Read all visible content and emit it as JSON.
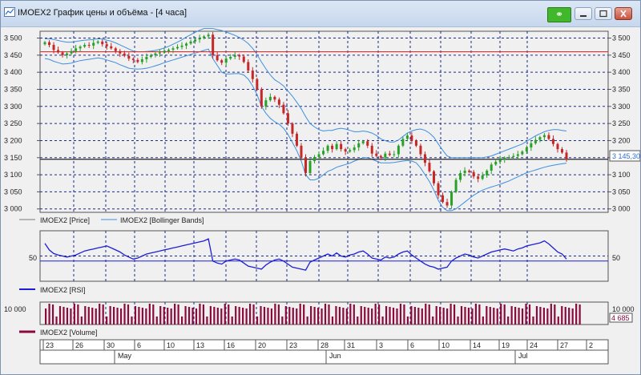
{
  "window": {
    "title": "IMOEX2 График цены и объёма - [4 часа]",
    "link_icon": "link-icon",
    "buttons": [
      "minimize-icon",
      "maximize-icon",
      "close-icon"
    ]
  },
  "chart_data": [
    {
      "type": "candlestick",
      "title": "",
      "ylim": [
        2990,
        3520
      ],
      "yticks": [
        "3 500",
        "3 450",
        "3 400",
        "3 350",
        "3 300",
        "3 250",
        "3 200",
        "3 150",
        "3 100",
        "3 050",
        "3 000"
      ],
      "ytick_values": [
        3500,
        3450,
        3400,
        3350,
        3300,
        3250,
        3200,
        3150,
        3100,
        3050,
        3000
      ],
      "hline_red": 3460,
      "hline_black": 3145.3,
      "last_price_label": "3 145,30",
      "close": [
        3488,
        3480,
        3465,
        3458,
        3450,
        3455,
        3462,
        3470,
        3475,
        3480,
        3478,
        3486,
        3490,
        3482,
        3476,
        3470,
        3462,
        3455,
        3448,
        3440,
        3436,
        3430,
        3438,
        3445,
        3450,
        3455,
        3458,
        3462,
        3466,
        3470,
        3474,
        3478,
        3484,
        3490,
        3496,
        3500,
        3505,
        3510,
        3450,
        3435,
        3428,
        3440,
        3445,
        3450,
        3446,
        3430,
        3405,
        3380,
        3350,
        3300,
        3318,
        3328,
        3320,
        3305,
        3280,
        3250,
        3220,
        3185,
        3150,
        3105,
        3140,
        3152,
        3160,
        3170,
        3185,
        3175,
        3190,
        3175,
        3168,
        3172,
        3180,
        3192,
        3198,
        3185,
        3162,
        3155,
        3150,
        3162,
        3158,
        3160,
        3185,
        3205,
        3215,
        3200,
        3185,
        3160,
        3135,
        3110,
        3075,
        3040,
        3020,
        3010,
        3050,
        3085,
        3105,
        3112,
        3108,
        3095,
        3088,
        3098,
        3112,
        3130,
        3138,
        3145,
        3150,
        3152,
        3155,
        3160,
        3168,
        3180,
        3192,
        3202,
        3210,
        3216,
        3205,
        3190,
        3175,
        3165,
        3145
      ],
      "bollinger": {
        "upper": [
          3498,
          3498,
          3496,
          3493,
          3490,
          3488,
          3488,
          3490,
          3492,
          3494,
          3495,
          3496,
          3498,
          3497,
          3494,
          3491,
          3486,
          3480,
          3474,
          3468,
          3462,
          3460,
          3460,
          3461,
          3462,
          3464,
          3467,
          3471,
          3476,
          3482,
          3488,
          3495,
          3503,
          3510,
          3517,
          3523,
          3528,
          3528,
          3528,
          3525,
          3522,
          3518,
          3513,
          3508,
          3502,
          3494,
          3484,
          3470,
          3452,
          3430,
          3410,
          3392,
          3378,
          3370,
          3360,
          3345,
          3330,
          3312,
          3293,
          3270,
          3250,
          3240,
          3232,
          3228,
          3230,
          3230,
          3234,
          3236,
          3234,
          3230,
          3226,
          3226,
          3228,
          3226,
          3222,
          3215,
          3205,
          3200,
          3196,
          3196,
          3202,
          3212,
          3222,
          3228,
          3232,
          3234,
          3230,
          3222,
          3210,
          3190,
          3172,
          3155,
          3150,
          3150,
          3150,
          3150,
          3150,
          3150,
          3150,
          3150,
          3152,
          3155,
          3160,
          3165,
          3170,
          3175,
          3180,
          3185,
          3190,
          3198,
          3206,
          3214,
          3220,
          3226,
          3230,
          3232,
          3232,
          3230,
          3228
        ],
        "lower": [
          3440,
          3438,
          3432,
          3428,
          3424,
          3425,
          3427,
          3431,
          3434,
          3436,
          3438,
          3440,
          3442,
          3440,
          3436,
          3432,
          3428,
          3422,
          3417,
          3412,
          3410,
          3409,
          3410,
          3412,
          3415,
          3419,
          3423,
          3428,
          3432,
          3436,
          3440,
          3444,
          3448,
          3452,
          3456,
          3460,
          3464,
          3468,
          3440,
          3420,
          3400,
          3395,
          3395,
          3396,
          3396,
          3392,
          3380,
          3360,
          3335,
          3300,
          3280,
          3265,
          3255,
          3248,
          3236,
          3218,
          3195,
          3170,
          3140,
          3100,
          3085,
          3085,
          3090,
          3100,
          3110,
          3115,
          3122,
          3126,
          3130,
          3134,
          3140,
          3145,
          3150,
          3150,
          3145,
          3140,
          3135,
          3135,
          3135,
          3136,
          3138,
          3140,
          3142,
          3140,
          3135,
          3120,
          3100,
          3080,
          3055,
          3025,
          3005,
          2995,
          2995,
          3000,
          3010,
          3020,
          3030,
          3040,
          3048,
          3055,
          3060,
          3064,
          3068,
          3072,
          3077,
          3082,
          3088,
          3094,
          3100,
          3106,
          3110,
          3114,
          3118,
          3122,
          3125,
          3128,
          3130,
          3132,
          3134
        ]
      },
      "legend": [
        "IMOEX2 [Price]",
        "IMOEX2 [Bollinger Bands]"
      ]
    },
    {
      "type": "line",
      "title": "",
      "ylim": [
        0,
        100
      ],
      "yticks": [
        "50"
      ],
      "hline": 40,
      "values": [
        75,
        62,
        55,
        52,
        50,
        48,
        50,
        52,
        56,
        60,
        62,
        64,
        66,
        68,
        70,
        66,
        62,
        58,
        52,
        48,
        44,
        46,
        50,
        54,
        56,
        58,
        60,
        62,
        64,
        66,
        68,
        70,
        72,
        74,
        76,
        78,
        80,
        84,
        40,
        36,
        34,
        40,
        42,
        44,
        42,
        36,
        30,
        28,
        26,
        24,
        32,
        38,
        42,
        44,
        40,
        34,
        28,
        26,
        24,
        22,
        38,
        42,
        46,
        50,
        54,
        50,
        56,
        50,
        48,
        52,
        54,
        58,
        60,
        54,
        46,
        44,
        42,
        48,
        46,
        48,
        54,
        58,
        60,
        52,
        46,
        40,
        34,
        30,
        28,
        24,
        26,
        28,
        40,
        46,
        50,
        54,
        52,
        48,
        46,
        50,
        54,
        58,
        60,
        62,
        64,
        62,
        60,
        64,
        66,
        70,
        72,
        74,
        76,
        80,
        74,
        66,
        58,
        54,
        44
      ],
      "legend": "IMOEX2 [RSI]"
    },
    {
      "type": "bar",
      "title": "",
      "ytick": "10 000",
      "last_value_label": "4 685",
      "legend": "IMOEX2 [Volume]"
    }
  ],
  "time_axis": {
    "days": [
      "23",
      "26",
      "30",
      "6",
      "10",
      "13",
      "16",
      "20",
      "23",
      "28",
      "31",
      "3",
      "6",
      "10",
      "14",
      "19",
      "24",
      "27",
      "2"
    ],
    "months": [
      "May",
      "Jun",
      "Jul"
    ]
  },
  "colors": {
    "up": "#27a127",
    "down": "#c62828",
    "bollinger": "#3d8fe0",
    "rsi": "#1d1fd6",
    "volume": "#8b0a3c",
    "grid": "#1a2a8a",
    "hline_red": "#e03434"
  }
}
